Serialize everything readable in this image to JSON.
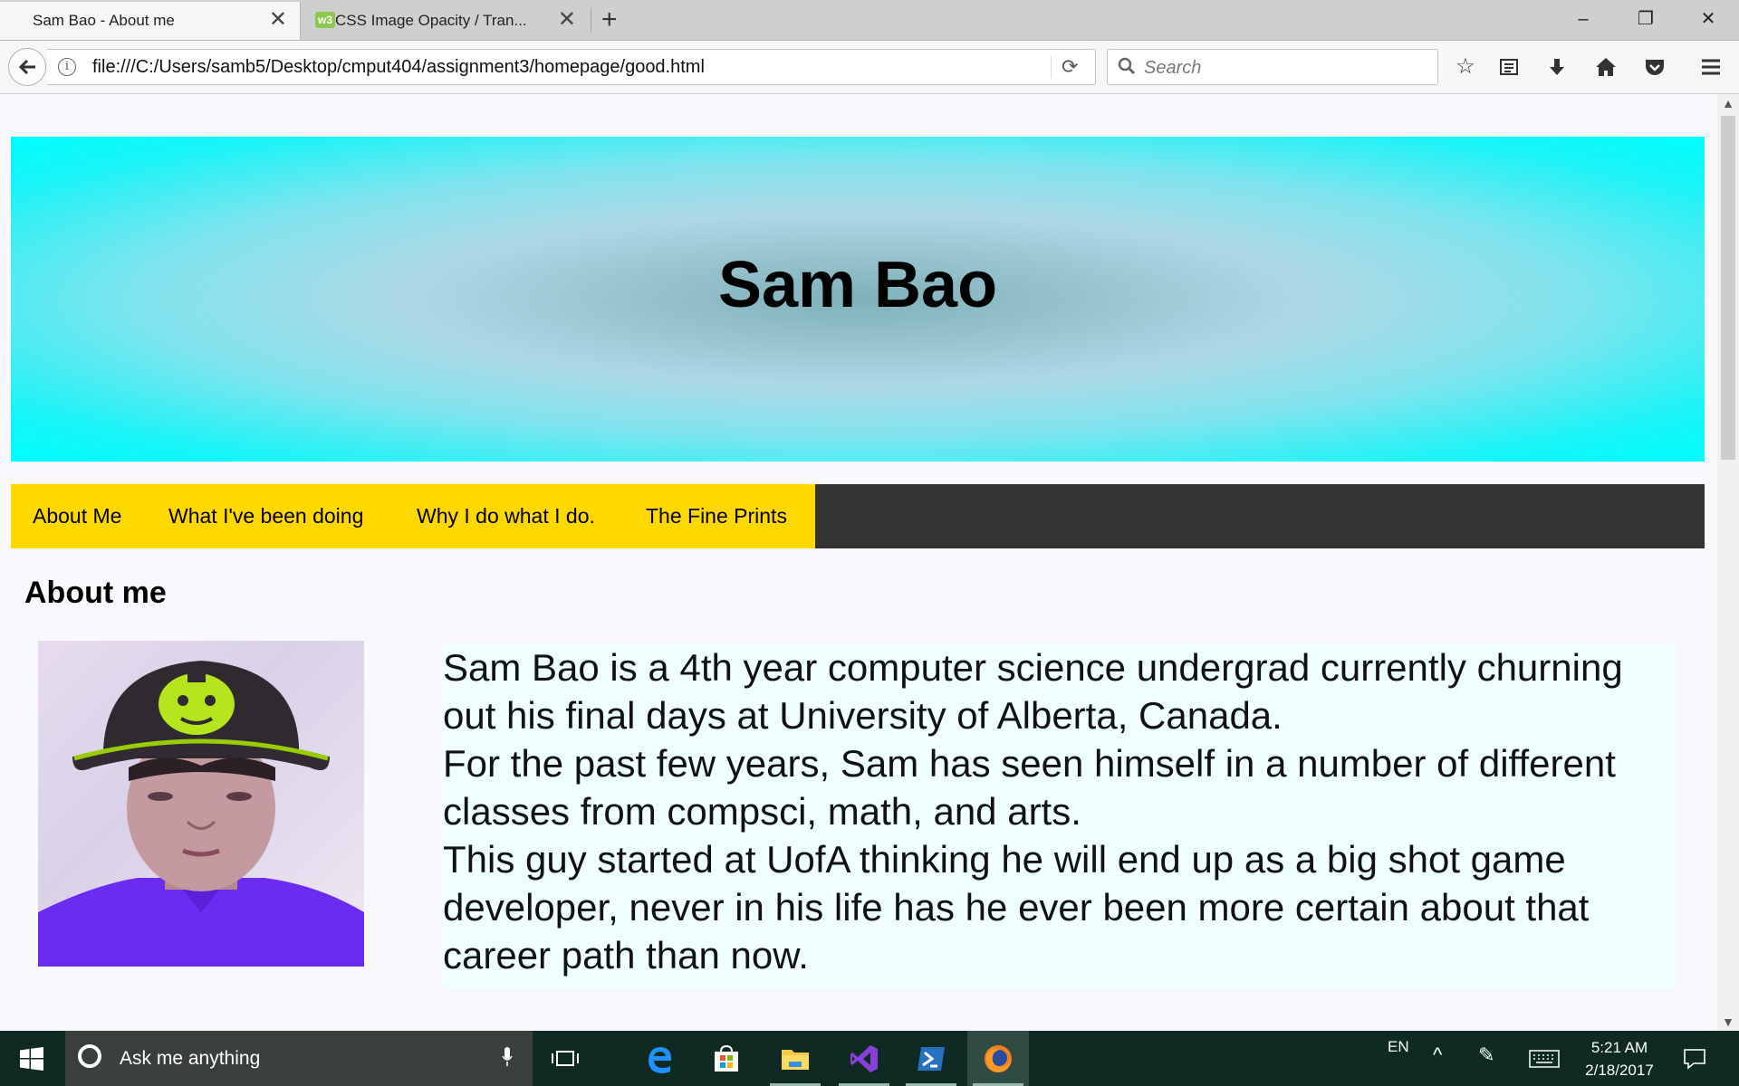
{
  "browser": {
    "tabs": [
      {
        "title": "Sam Bao - About me",
        "active": true
      },
      {
        "title": "CSS Image Opacity / Tran...",
        "favicon": "w3",
        "active": false
      }
    ],
    "address": "file:///C:/Users/samb5/Desktop/cmput404/assignment3/homepage/good.html",
    "search_placeholder": "Search",
    "toolbar_icons": [
      "star-icon",
      "reading-list-icon",
      "download-icon",
      "home-icon",
      "pocket-icon",
      "menu-icon"
    ]
  },
  "page": {
    "hero_title": "Sam Bao",
    "menu": [
      "About Me",
      "What I've been doing",
      "Why I do what I do.",
      "The Fine Prints"
    ],
    "section_title": "About me",
    "bio": [
      "Sam Bao is a 4th year computer science undergrad currently churning out his final days at University of Alberta, Canada.",
      "For the past few years, Sam has seen himself in a number of different classes from compsci, math, and arts.",
      "This guy started at UofA thinking he will end up as a big shot game developer, never in his life has he ever been more certain about that career path than now."
    ],
    "colors": {
      "hero_edge": "#00ffff",
      "hero_center": "#7fb1b9",
      "menu_active_bg": "#ffd800",
      "menu_bg": "#333333",
      "bio_bg": "#f0ffff"
    }
  },
  "taskbar": {
    "search_text": "Ask me anything",
    "language": "EN",
    "time": "5:21 AM",
    "date": "2/18/2017",
    "apps": [
      "task-view-icon",
      "edge-icon",
      "store-icon",
      "file-explorer-icon",
      "visual-studio-icon",
      "powershell-icon",
      "firefox-icon"
    ]
  }
}
